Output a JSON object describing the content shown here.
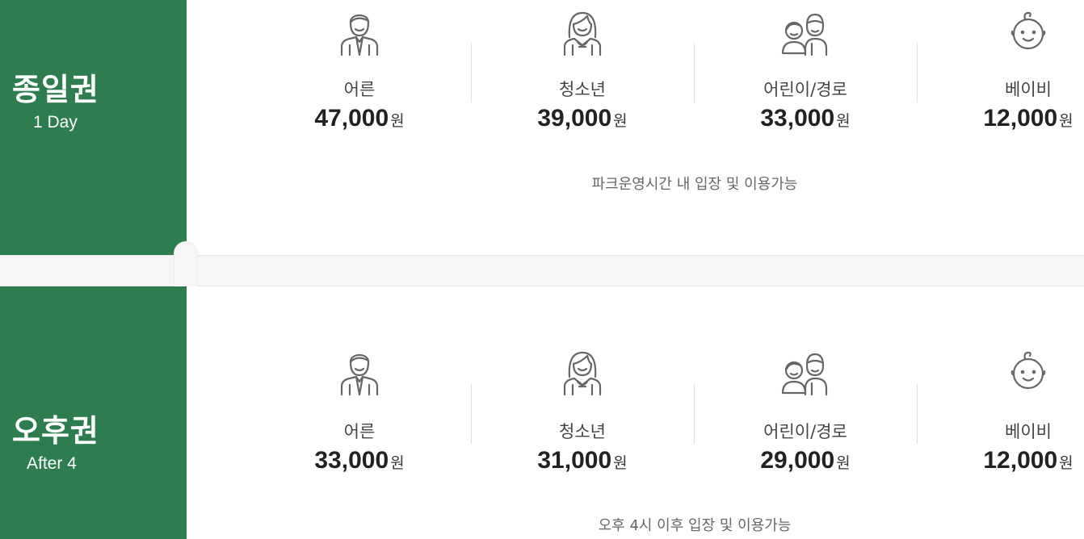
{
  "passes": [
    {
      "title": "종일권",
      "subtitle": "1 Day",
      "note": "파크운영시간 내 입장 및 이용가능",
      "tiers": [
        {
          "icon": "adult-man-icon",
          "label": "어른",
          "price": "47,000",
          "unit": "원"
        },
        {
          "icon": "teen-girl-icon",
          "label": "청소년",
          "price": "39,000",
          "unit": "원"
        },
        {
          "icon": "child-senior-icon",
          "label": "어린이/경로",
          "price": "33,000",
          "unit": "원"
        },
        {
          "icon": "baby-icon",
          "label": "베이비",
          "price": "12,000",
          "unit": "원"
        }
      ]
    },
    {
      "title": "오후권",
      "subtitle": "After 4",
      "note": "오후 4시 이후 입장 및 이용가능",
      "tiers": [
        {
          "icon": "adult-man-icon",
          "label": "어른",
          "price": "33,000",
          "unit": "원"
        },
        {
          "icon": "teen-girl-icon",
          "label": "청소년",
          "price": "31,000",
          "unit": "원"
        },
        {
          "icon": "child-senior-icon",
          "label": "어린이/경로",
          "price": "29,000",
          "unit": "원"
        },
        {
          "icon": "baby-icon",
          "label": "베이비",
          "price": "12,000",
          "unit": "원"
        }
      ]
    }
  ],
  "colors": {
    "accent": "#2e7d4f",
    "divider": "#f6f6f6",
    "text": "#333333",
    "muted": "#666666"
  }
}
